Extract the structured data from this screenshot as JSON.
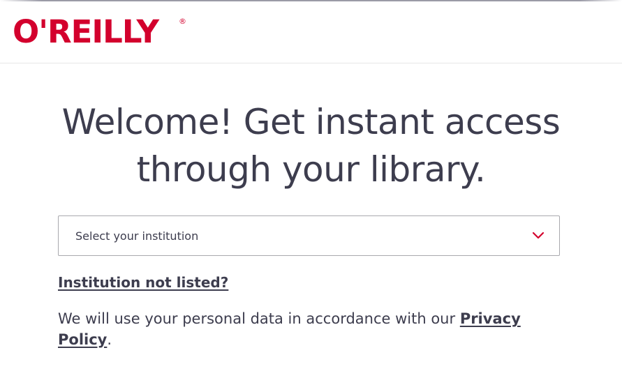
{
  "header": {
    "logo_text": "O'REILLY",
    "logo_registered": "®",
    "brand_color": "#d3002d"
  },
  "main": {
    "heading_line1": "Welcome! Get instant access",
    "heading_line2": "through your library.",
    "institution_select": {
      "placeholder": "Select your institution",
      "icon": "chevron-down-icon"
    },
    "not_listed_link": "Institution not listed?",
    "privacy": {
      "text_before": "We will use your personal data in accordance with our ",
      "link_label": "Privacy Policy",
      "text_after": "."
    }
  }
}
